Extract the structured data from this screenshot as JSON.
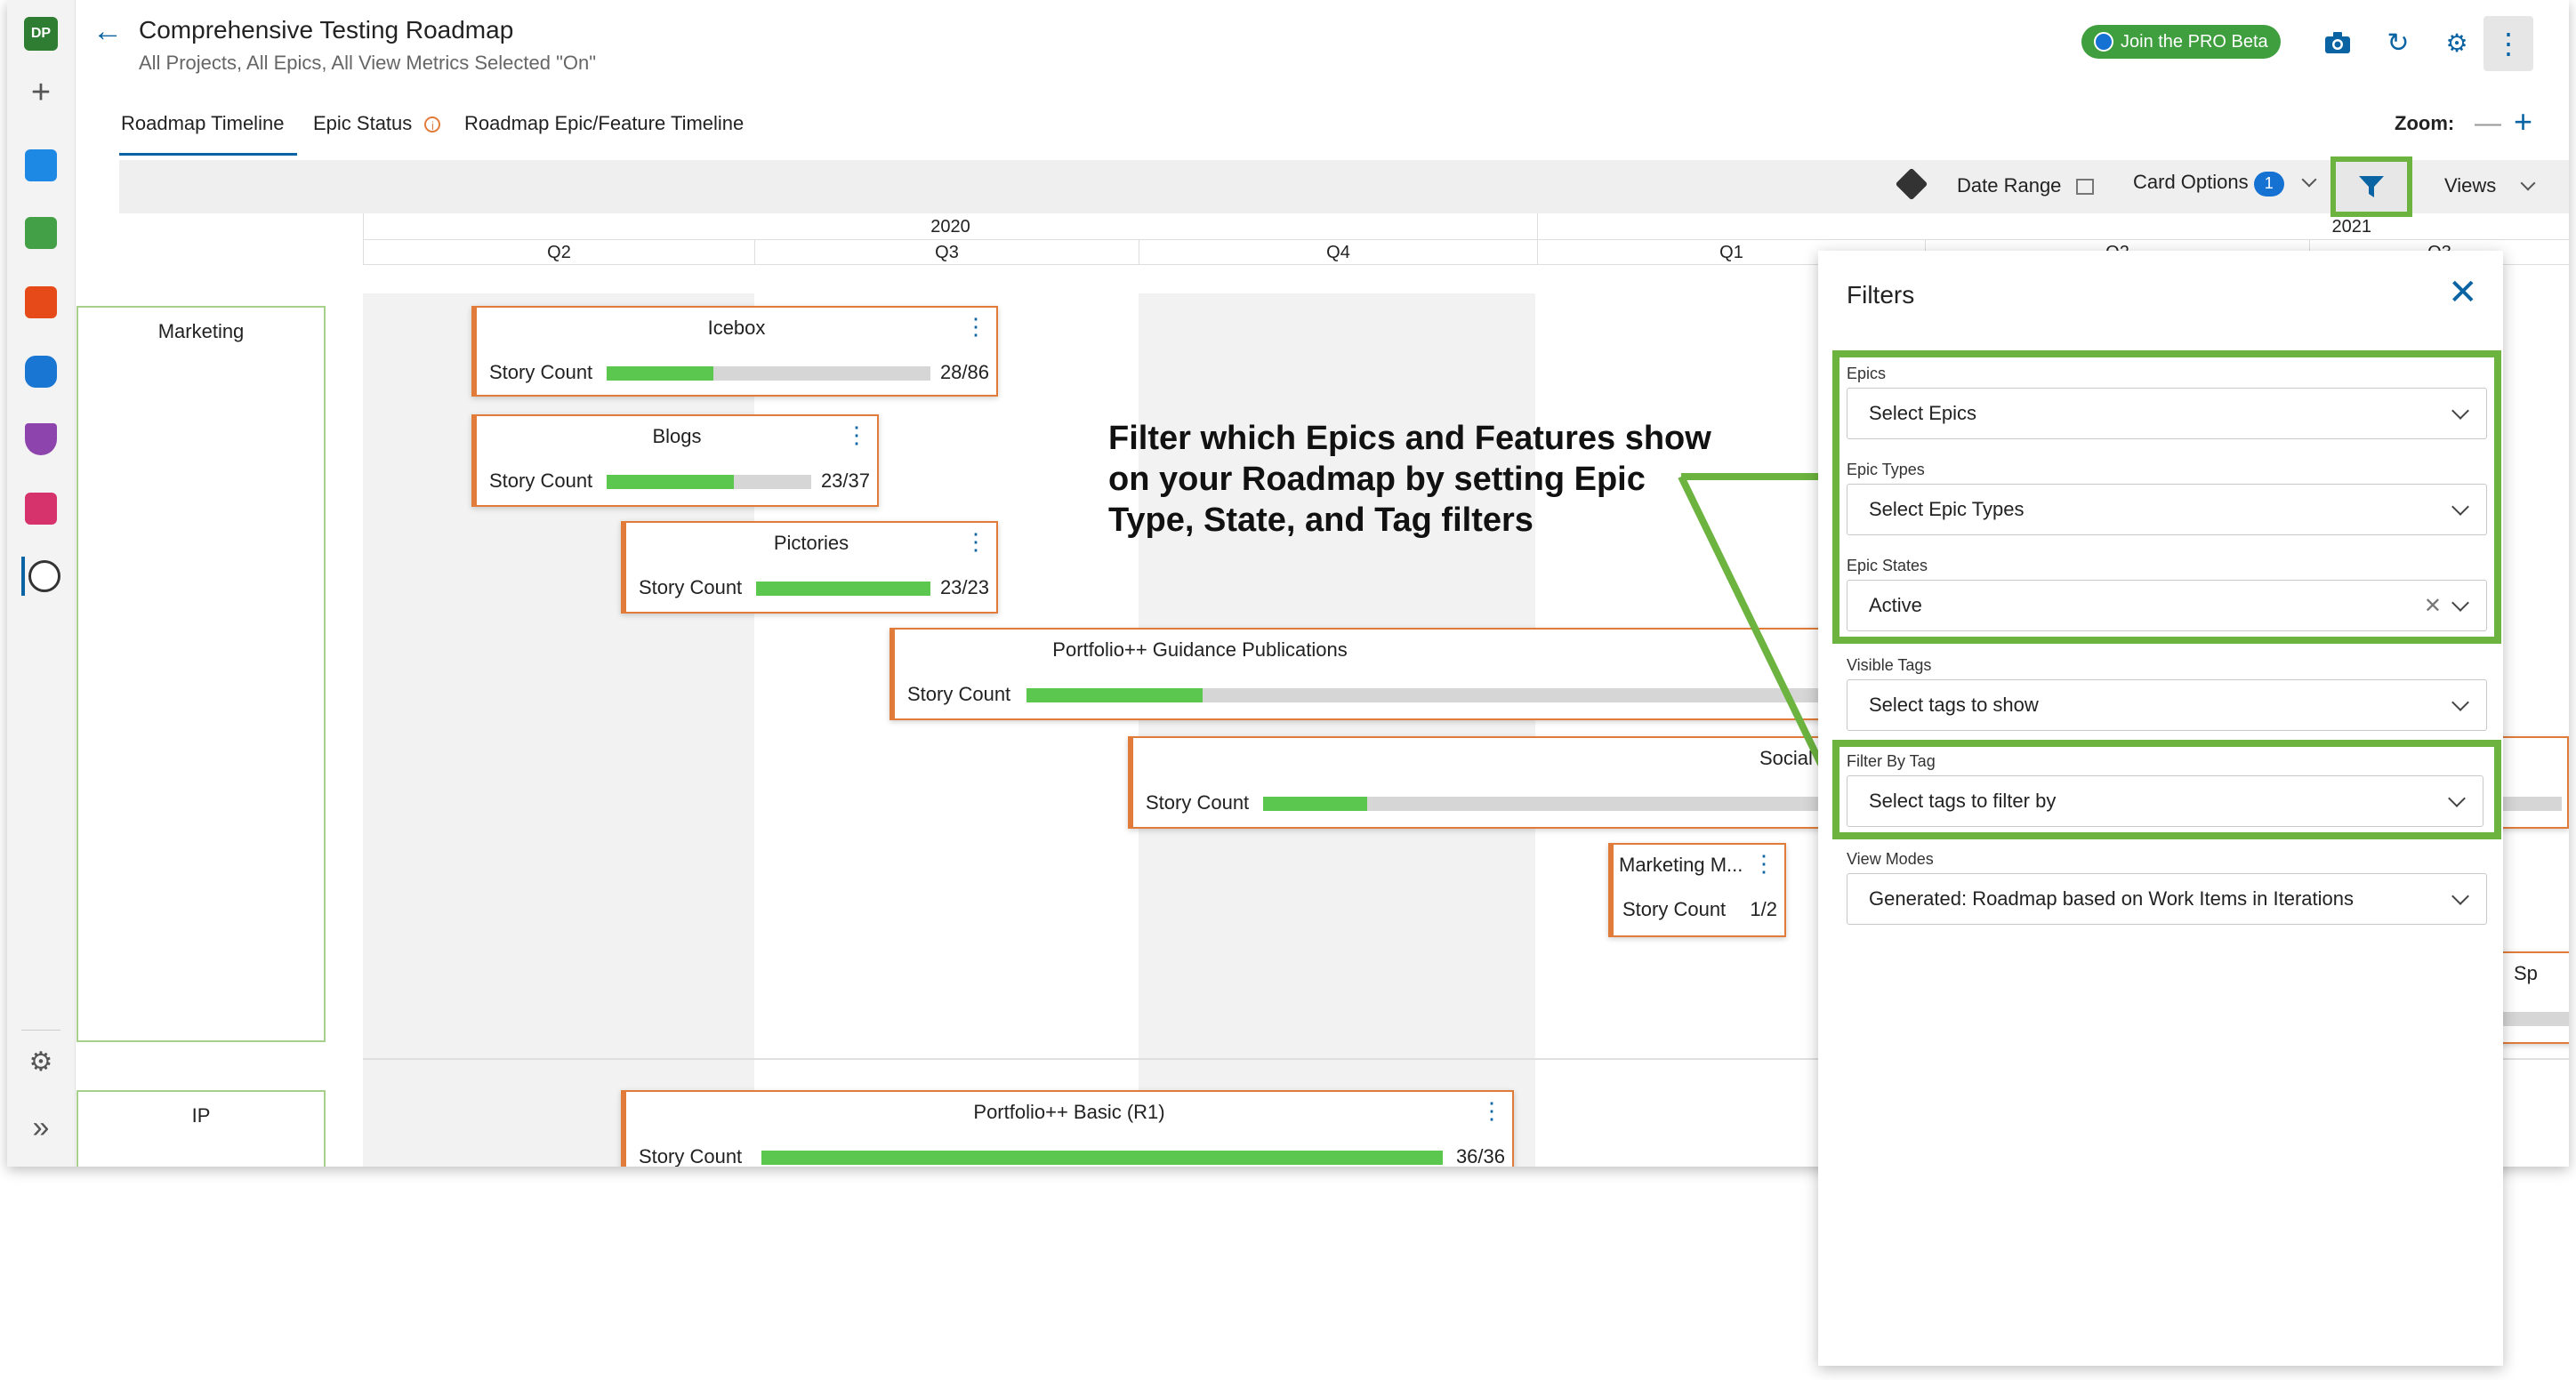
{
  "header": {
    "title": "Comprehensive Testing Roadmap",
    "subtitle": "All Projects, All Epics, All View Metrics Selected \"On\"",
    "pro_label": "Join the PRO Beta",
    "avatar": "DP"
  },
  "tabs": [
    {
      "label": "Roadmap Timeline"
    },
    {
      "label": "Epic Status"
    },
    {
      "label": "Roadmap Epic/Feature Timeline"
    }
  ],
  "zoom_label": "Zoom:",
  "toolbar": {
    "date_range": "Date Range",
    "card_options": "Card Options",
    "card_options_count": "1",
    "views": "Views"
  },
  "timeline": {
    "years": [
      "2020",
      "2021"
    ],
    "quarters": [
      "Q2",
      "Q3",
      "Q4",
      "Q1",
      "Q2",
      "Q3"
    ]
  },
  "lanes": [
    {
      "name": "Marketing"
    },
    {
      "name": "IP"
    }
  ],
  "cards": [
    {
      "title": "Icebox",
      "label": "Story Count",
      "count": "28/86",
      "progress": 0.33
    },
    {
      "title": "Blogs",
      "label": "Story Count",
      "count": "23/37",
      "progress": 0.62
    },
    {
      "title": "Pictories",
      "label": "Story Count",
      "count": "23/23",
      "progress": 1.0
    },
    {
      "title": "Portfolio++ Guidance Publications",
      "label": "Story Count",
      "count": "",
      "progress": 0.19
    },
    {
      "title": "Social",
      "label": "Story Count",
      "count": "",
      "progress": 0.08
    },
    {
      "title": "Marketing M...",
      "label": "Story Count",
      "count": "1/2",
      "progress": 0.5
    },
    {
      "title": "Portfolio++ Basic (R1)",
      "label": "Story Count",
      "count": "36/36",
      "progress": 1.0
    }
  ],
  "partial_text": "Sp",
  "callout": "Filter which Epics and Features show on your Roadmap by setting Epic Type, State, and Tag filters",
  "filters": {
    "title": "Filters",
    "epics": {
      "label": "Epics",
      "value": "Select Epics"
    },
    "epic_types": {
      "label": "Epic Types",
      "value": "Select Epic Types"
    },
    "epic_states": {
      "label": "Epic States",
      "value": "Active"
    },
    "visible_tags": {
      "label": "Visible Tags",
      "value": "Select tags to show"
    },
    "filter_by_tag": {
      "label": "Filter By Tag",
      "value": "Select tags to filter by"
    },
    "view_modes": {
      "label": "View Modes",
      "value": "Generated: Roadmap based on Work Items in Iterations"
    }
  },
  "colors": {
    "accent": "#0a64a4",
    "highlight": "#6cb33f",
    "card_border": "#e07b39",
    "progress": "#5cc74f"
  }
}
